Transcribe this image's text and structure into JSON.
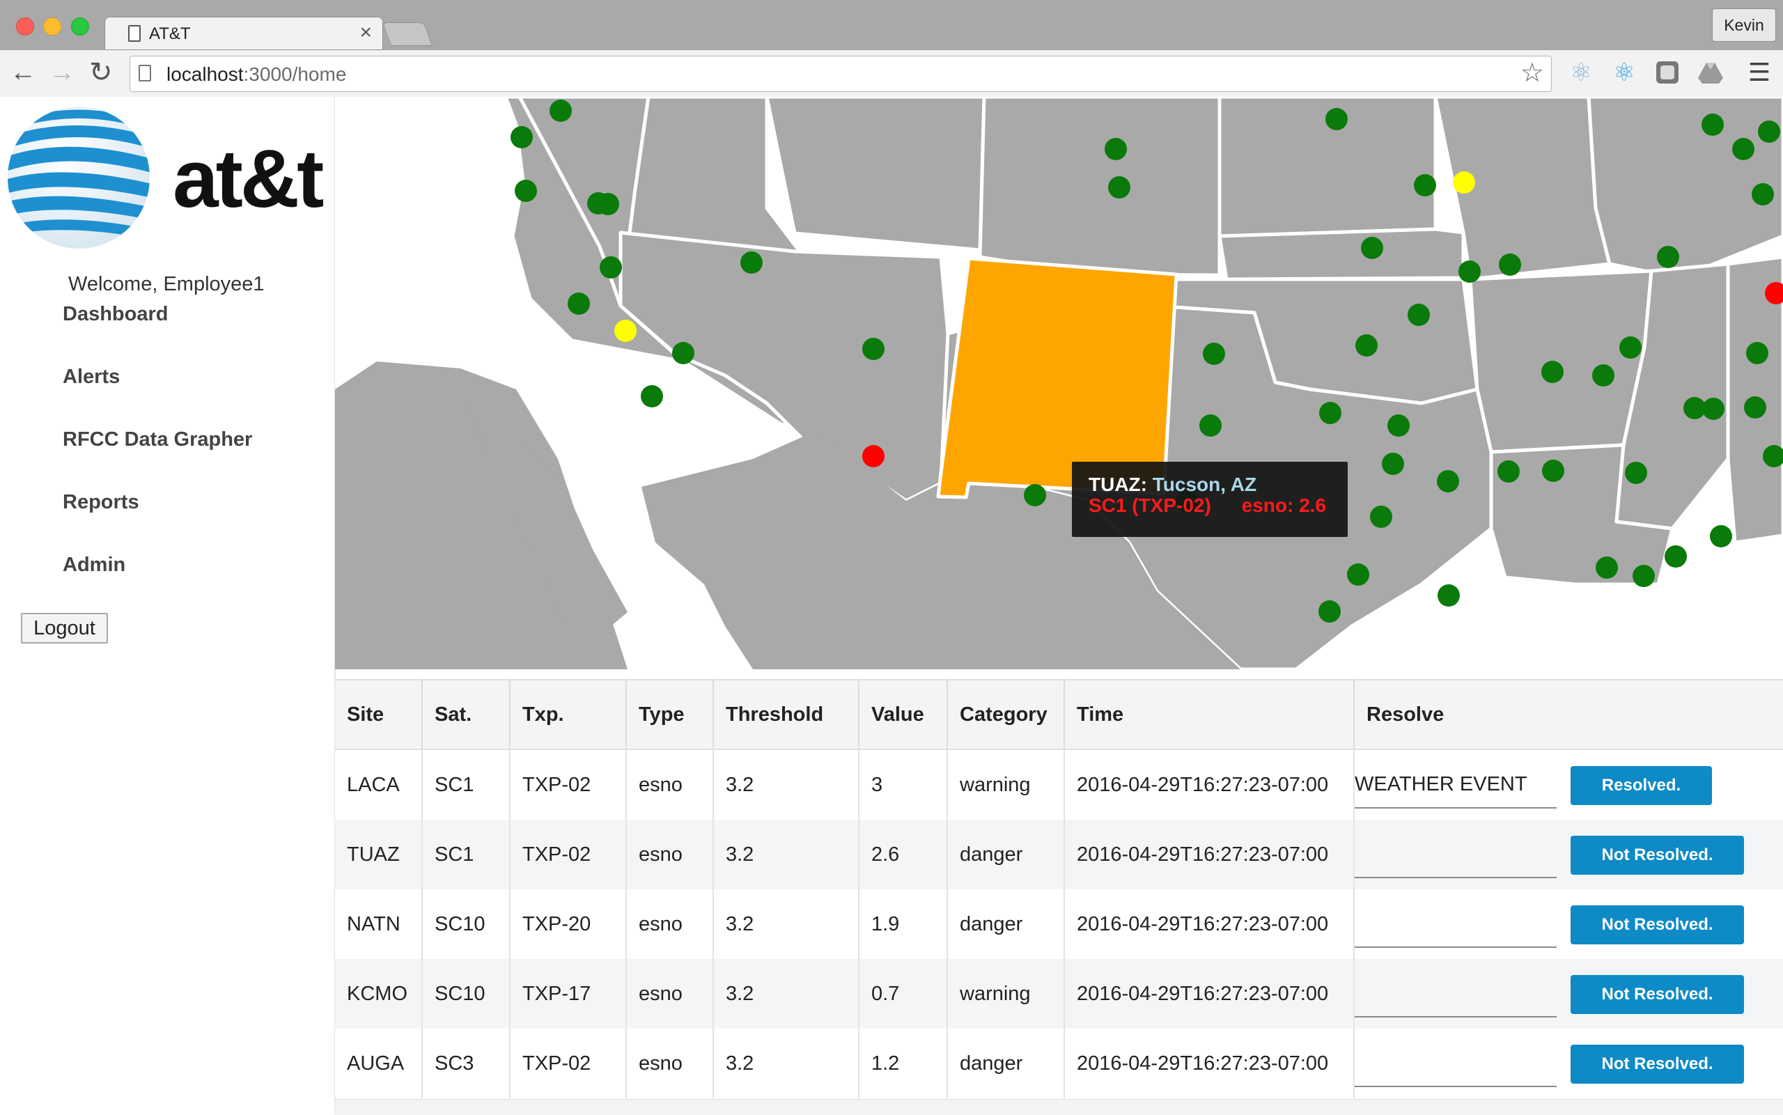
{
  "browser": {
    "tab_title": "AT&T",
    "tab_close": "×",
    "url_host": "localhost",
    "url_path": ":3000/home",
    "profile": "Kevin"
  },
  "icons": {
    "back": "arrow-left-icon",
    "forward": "arrow-right-icon",
    "reload": "reload-icon",
    "star": "star-icon",
    "menu": "hamburger-menu-icon"
  },
  "sidebar": {
    "logo_text": "at&t",
    "welcome": "Welcome, Employee1",
    "nav": [
      "Dashboard",
      "Alerts",
      "RFCC Data Grapher",
      "Reports",
      "Admin"
    ],
    "logout": "Logout"
  },
  "colors": {
    "ok": "#0a7a0a",
    "warning": "#ffff00",
    "danger": "#ff0000",
    "highlight_state": "#ffa500",
    "land": "#a9a9a9",
    "button": "#0e8ac6"
  },
  "map": {
    "tooltip": {
      "site": "TUAZ:",
      "location": "Tucson, AZ",
      "sat_txp": "SC1 (TXP-02)",
      "metric": "esno: 2.6"
    }
  },
  "table": {
    "headers": [
      "Site",
      "Sat.",
      "Txp.",
      "Type",
      "Threshold",
      "Value",
      "Category",
      "Time",
      "Resolve"
    ],
    "rows": [
      {
        "site": "LACA",
        "sat": "SC1",
        "txp": "TXP-02",
        "type": "esno",
        "threshold": "3.2",
        "value": "3",
        "category": "warning",
        "time": "2016-04-29T16:27:23-07:00",
        "resolve_text": "WEATHER EVENT",
        "status": "Resolved."
      },
      {
        "site": "TUAZ",
        "sat": "SC1",
        "txp": "TXP-02",
        "type": "esno",
        "threshold": "3.2",
        "value": "2.6",
        "category": "danger",
        "time": "2016-04-29T16:27:23-07:00",
        "resolve_text": "",
        "status": "Not Resolved."
      },
      {
        "site": "NATN",
        "sat": "SC10",
        "txp": "TXP-20",
        "type": "esno",
        "threshold": "3.2",
        "value": "1.9",
        "category": "danger",
        "time": "2016-04-29T16:27:23-07:00",
        "resolve_text": "",
        "status": "Not Resolved."
      },
      {
        "site": "KCMO",
        "sat": "SC10",
        "txp": "TXP-17",
        "type": "esno",
        "threshold": "3.2",
        "value": "0.7",
        "category": "warning",
        "time": "2016-04-29T16:27:23-07:00",
        "resolve_text": "",
        "status": "Not Resolved."
      },
      {
        "site": "AUGA",
        "sat": "SC3",
        "txp": "TXP-02",
        "type": "esno",
        "threshold": "3.2",
        "value": "1.2",
        "category": "danger",
        "time": "2016-04-29T16:27:23-07:00",
        "resolve_text": "",
        "status": "Not Resolved."
      }
    ]
  }
}
